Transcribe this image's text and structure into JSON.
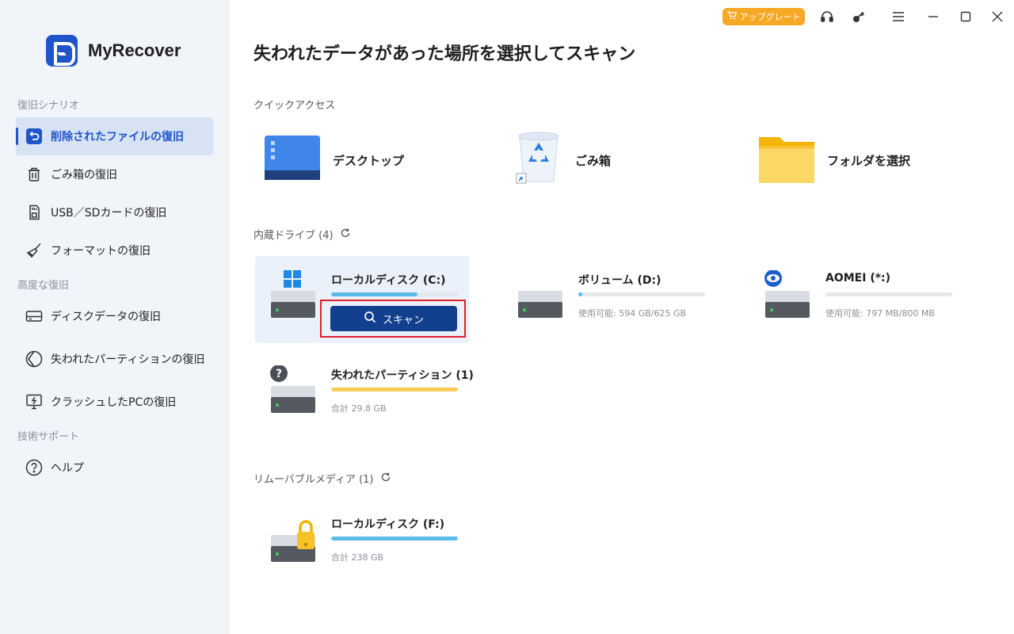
{
  "app": {
    "name": "MyRecover"
  },
  "titlebar": {
    "upgrade_label": "アップグレート"
  },
  "sidebar": {
    "sections": [
      {
        "label": "復旧シナリオ"
      },
      {
        "label": "高度な復旧"
      },
      {
        "label": "技術サポート"
      }
    ],
    "items": [
      {
        "label": "削除されたファイルの復旧",
        "icon": "undo-icon",
        "active": true
      },
      {
        "label": "ごみ箱の復旧",
        "icon": "trash-icon"
      },
      {
        "label": "USB／SDカードの復旧",
        "icon": "sd-card-icon"
      },
      {
        "label": "フォーマットの復旧",
        "icon": "broom-icon"
      },
      {
        "label": "ディスクデータの復旧",
        "icon": "disk-icon"
      },
      {
        "label": "失われたパーティションの復旧",
        "icon": "partition-icon"
      },
      {
        "label": "クラッシュしたPCの復旧",
        "icon": "crashed-pc-icon"
      },
      {
        "label": "ヘルプ",
        "icon": "help-icon"
      }
    ]
  },
  "main": {
    "title": "失われたデータがあった場所を選択してスキャン",
    "quick_access": {
      "label": "クイックアクセス",
      "items": [
        {
          "label": "デスクトップ",
          "icon": "desktop-icon"
        },
        {
          "label": "ごみ箱",
          "icon": "recycle-bin-icon"
        },
        {
          "label": "フォルダを選択",
          "icon": "folder-icon"
        }
      ]
    },
    "internal_drives": {
      "label": "内蔵ドライブ (4)",
      "drives": [
        {
          "name": "ローカルディスク (C:)",
          "info": "",
          "usage": 0.68,
          "color": "#5bbbe8",
          "badge": "windows-logo-icon"
        },
        {
          "name": "ボリューム (D:)",
          "info": "使用可能: 594 GB/625 GB",
          "usage": 0.03,
          "color": "#5bbbe8",
          "badge": ""
        },
        {
          "name": "AOMEI (*:)",
          "info": "使用可能: 797 MB/800 MB",
          "usage": 0.0,
          "color": "#5bbbe8",
          "badge": "eye-icon"
        },
        {
          "name": "失われたパーティション (1)",
          "info": "合計 29.8 GB",
          "usage": 1.0,
          "color": "#f9cc5a",
          "badge": "question-icon"
        }
      ],
      "scan_label": "スキャン"
    },
    "removable": {
      "label": "リムーバブルメディア (1)",
      "drives": [
        {
          "name": "ローカルディスク (F:)",
          "info": "合計 238 GB",
          "usage": 1.0,
          "color": "#5bbbe8",
          "badge": "lock-icon"
        }
      ]
    }
  }
}
